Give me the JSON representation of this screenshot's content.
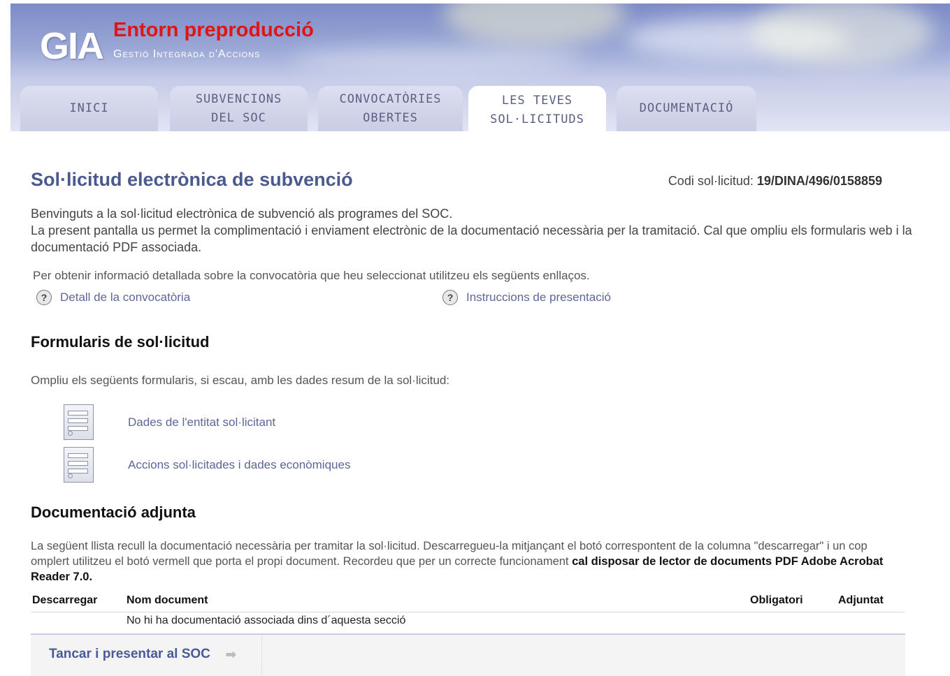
{
  "header": {
    "logo": "GIA",
    "environment": "Entorn preproducció",
    "subtitle": "Gestió Integrada d'Accions",
    "tabs": [
      {
        "label": "INICI"
      },
      {
        "label": "SUBVENCIONS\nDEL SOC"
      },
      {
        "label": "CONVOCATÒRIES\nOBERTES"
      },
      {
        "label": "LES TEVES\nSOL·LICITUDS",
        "active": true
      },
      {
        "label": "DOCUMENTACIÓ"
      }
    ]
  },
  "page": {
    "title": "Sol·licitud electrònica de subvenció",
    "code_label": "Codi sol·licitud: ",
    "code_value": "19/DINA/496/0158859",
    "intro_line1": "Benvinguts a la sol·licitud electrònica de subvenció als programes del SOC.",
    "intro_line2": "La present pantalla us permet la complimentació i enviament electrònic de la documentació necessària per la tramitació. Cal que ompliu els formularis web i la documentació PDF associada.",
    "info_line": "Per obtenir informació detallada sobre la convocatòria que heu seleccionat utilitzeu els següents enllaços.",
    "help_links": [
      {
        "label": "Detall de la convocatòria",
        "icon": "help-icon"
      },
      {
        "label": "Instruccions de presentació",
        "icon": "help-icon"
      }
    ]
  },
  "forms": {
    "heading": "Formularis de sol·licitud",
    "description": "Ompliu els següents formularis, si escau, amb les dades resum de la sol·licitud:",
    "items": [
      {
        "label": "Dades de l'entitat sol·licitant",
        "icon": "form-icon"
      },
      {
        "label": "Accions sol·licitades i dades econòmiques",
        "icon": "form-icon"
      }
    ]
  },
  "documents": {
    "heading": "Documentació adjunta",
    "description": "La següent llista recull la documentació necessària per tramitar la sol·licitud. Descarregueu-la mitjançant el botó correspontent de la columna \"descarregar\" i un cop omplert utilitzeu el botó vermell que porta el propi document. Recordeu que per un correcte funcionament ",
    "description_bold": "cal disposar de lector de documents PDF Adobe Acrobat Reader 7.0.",
    "columns": [
      "Descarregar",
      "Nom document",
      "Obligatori",
      "Adjuntat"
    ],
    "empty_message": "No hi ha documentació associada dins d´aquesta secció"
  },
  "footer": {
    "submit_label": "Tancar i presentar al SOC",
    "submit_icon": "arrow-right-icon"
  },
  "colors": {
    "title": "#4a5a8f",
    "link": "#5c6699",
    "environment": "#e01515"
  }
}
